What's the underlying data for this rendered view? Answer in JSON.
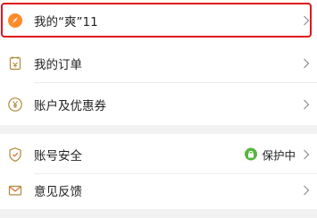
{
  "menu": {
    "items": [
      {
        "label": "我的“爽”11",
        "icon": "orange-rocket-icon"
      },
      {
        "label": "我的订单",
        "icon": "order-list-icon"
      },
      {
        "label": "账户及优惠券",
        "icon": "coupon-yen-icon"
      },
      {
        "label": "账号安全",
        "icon": "shield-icon",
        "status": "保护中"
      },
      {
        "label": "意见反馈",
        "icon": "envelope-icon"
      }
    ]
  },
  "colors": {
    "highlight": "#e0161c",
    "status_green": "#57b540",
    "icon_orange": "#ff7a1a",
    "icon_gray": "#9a9a9a"
  }
}
